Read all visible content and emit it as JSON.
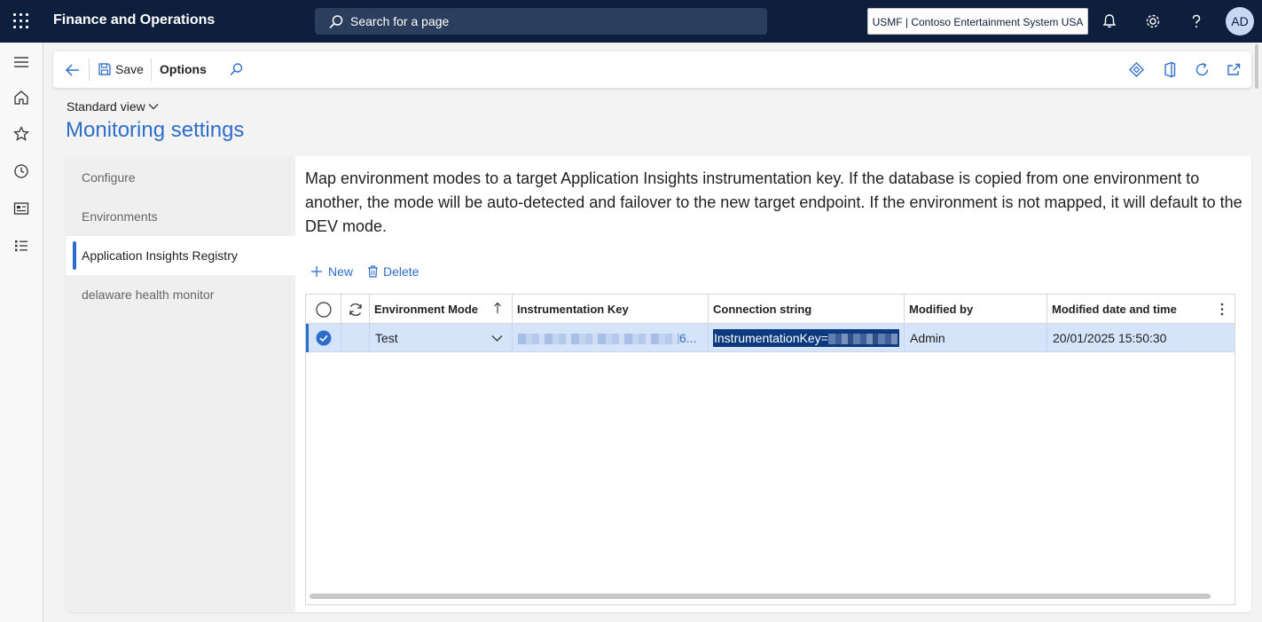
{
  "topbar": {
    "app_title": "Finance and Operations",
    "search_placeholder": "Search for a page",
    "company": "USMF | Contoso Entertainment System USA",
    "avatar": "AD"
  },
  "actionpane": {
    "save_label": "Save",
    "options_label": "Options"
  },
  "header": {
    "view": "Standard view",
    "title": "Monitoring settings"
  },
  "tabs": [
    {
      "label": "Configure"
    },
    {
      "label": "Environments"
    },
    {
      "label": "Application Insights Registry"
    },
    {
      "label": "delaware health monitor"
    }
  ],
  "intro": "Map environment modes to a target Application Insights instrumentation key. If the database is copied from one environment to another, the mode will be auto-detected and failover to the new target endpoint. If the environment is not mapped, it will default to the DEV mode.",
  "grid_actions": {
    "new_label": "New",
    "delete_label": "Delete"
  },
  "grid": {
    "columns": [
      "Environment Mode",
      "Instrumentation Key",
      "Connection string",
      "Modified by",
      "Modified date and time"
    ],
    "rows": [
      {
        "environment_mode": "Test",
        "instrumentation_key_suffix": "6...",
        "connection_string": "InstrumentationKey=",
        "modified_by": "Admin",
        "modified_datetime": "20/01/2025 15:50:30"
      }
    ]
  },
  "colors": {
    "accent": "#2e6ecb",
    "topbar": "#0d1f3d",
    "selected_row": "#d6e4f9"
  },
  "icons": [
    "waffle-icon",
    "search-icon",
    "bell-icon",
    "gear-icon",
    "help-icon",
    "hamburger-icon",
    "home-icon",
    "star-icon",
    "clock-icon",
    "workspace-icon",
    "list-icon",
    "back-icon",
    "save-icon",
    "find-icon",
    "diamond-icon",
    "office-icon",
    "refresh-icon",
    "popout-icon",
    "plus-icon",
    "trash-icon",
    "refresh-grid-icon",
    "sort-arrow-icon",
    "chevron-down-icon",
    "more-icon"
  ]
}
